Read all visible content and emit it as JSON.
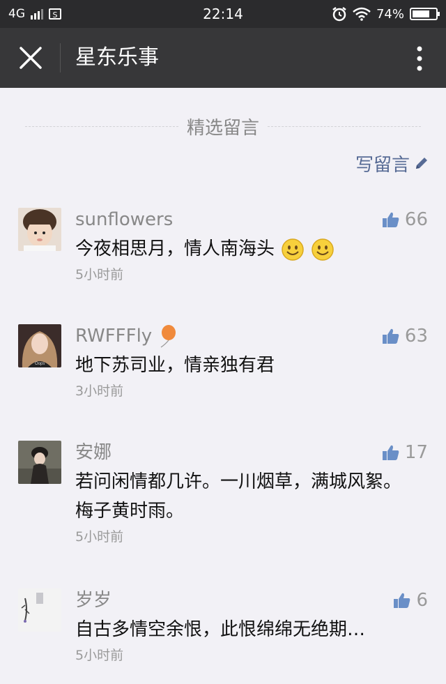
{
  "status_bar": {
    "network": "4G",
    "time": "22:14",
    "battery_percent": "74%",
    "battery_level": 0.74,
    "icons": [
      "signal-icon",
      "sim-icon",
      "alarm-icon",
      "wifi-icon",
      "battery-icon"
    ]
  },
  "nav": {
    "title": "星东乐事",
    "close_icon": "close-icon",
    "more_icon": "more-vertical-icon"
  },
  "section": {
    "title": "精选留言",
    "write_label": "写留言",
    "write_icon": "pencil-icon"
  },
  "comments": [
    {
      "name": "sunflowers",
      "text": "今夜相思月，情人南海头",
      "emoji_count": 2,
      "time": "5小时前",
      "likes": "66"
    },
    {
      "name": "RWFFFly",
      "name_badge": "balloon-icon",
      "text": "地下苏司业，情亲独有君",
      "time": "3小时前",
      "likes": "63"
    },
    {
      "name": "安娜",
      "text": "若问闲情都几许。一川烟草，满城风絮。梅子黄时雨。",
      "time": "5小时前",
      "likes": "17"
    },
    {
      "name": "岁岁",
      "text": "自古多情空余恨，此恨绵绵无绝期…",
      "time": "5小时前",
      "likes": "6"
    }
  ],
  "colors": {
    "status_bar_bg": "#2b2b2d",
    "nav_bg": "#373739",
    "page_bg": "#f2f1f6",
    "link": "#576b95",
    "like_icon": "#6a8fc7"
  }
}
